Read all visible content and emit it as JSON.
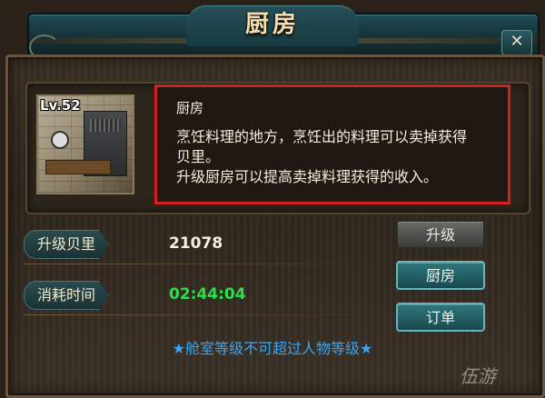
{
  "window": {
    "title": "厨房",
    "close_label": "✕"
  },
  "building": {
    "level": "Lv.52",
    "name": "厨房",
    "description_lines": [
      "烹饪料理的地方，烹饪出的料理可以卖掉获得",
      "贝里。",
      "升级厨房可以提高卖掉料理获得的收入。"
    ]
  },
  "stats": [
    {
      "label": "升级贝里",
      "value": "21078",
      "color": "#f4f0e0"
    },
    {
      "label": "消耗时间",
      "value": "02:44:04",
      "color": "#27e04a"
    }
  ],
  "buttons": {
    "upgrade": "升级",
    "kitchen": "厨房",
    "order": "订单"
  },
  "notice": "★舱室等级不可超过人物等级★",
  "watermark": "伍游"
}
